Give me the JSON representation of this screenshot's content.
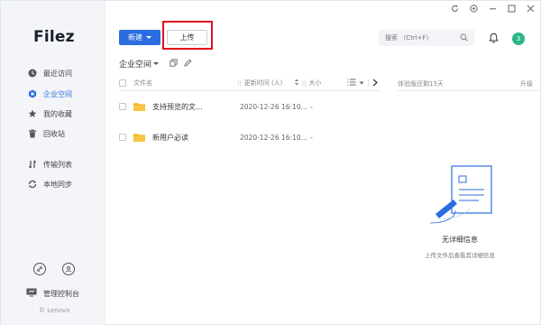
{
  "window": {
    "controls": [
      "refresh-icon",
      "settings-icon",
      "minimize-icon",
      "maximize-icon",
      "close-icon"
    ]
  },
  "sidebar": {
    "logo": "Filez",
    "items": [
      {
        "label": "最近访问",
        "icon": "clock-icon"
      },
      {
        "label": "企业空间",
        "icon": "enterprise-icon",
        "active": true
      },
      {
        "label": "我的收藏",
        "icon": "star-icon"
      },
      {
        "label": "回收站",
        "icon": "trash-icon"
      },
      {
        "label": "传输列表",
        "icon": "transfer-icon"
      },
      {
        "label": "本地同步",
        "icon": "sync-icon"
      }
    ],
    "admin_label": "管理控制台",
    "copyright": "© Lenovo"
  },
  "toolbar": {
    "new_label": "新建",
    "upload_label": "上传",
    "search_placeholder": "搜索 （Ctrl+F）",
    "avatar_text": "3"
  },
  "path": {
    "label": "企业空间"
  },
  "table": {
    "columns": {
      "name": "文件名",
      "time": "更新时间 (人)",
      "size": "大小"
    },
    "rows": [
      {
        "name": "支持预览的文...",
        "time": "2020-12-26 16:10...",
        "size": "-"
      },
      {
        "name": "新用户必读",
        "time": "2020-12-26 16:10...",
        "size": "-"
      }
    ]
  },
  "right_panel": {
    "trial_text": "体验版还剩15天",
    "upgrade_text": "升级",
    "empty_title": "无详细信息",
    "empty_sub": "上传文件后查看其详细信息"
  },
  "colors": {
    "accent": "#2b6de0",
    "highlight_box": "#e3121b",
    "folder": "#f5b521",
    "avatar": "#2db58a"
  }
}
